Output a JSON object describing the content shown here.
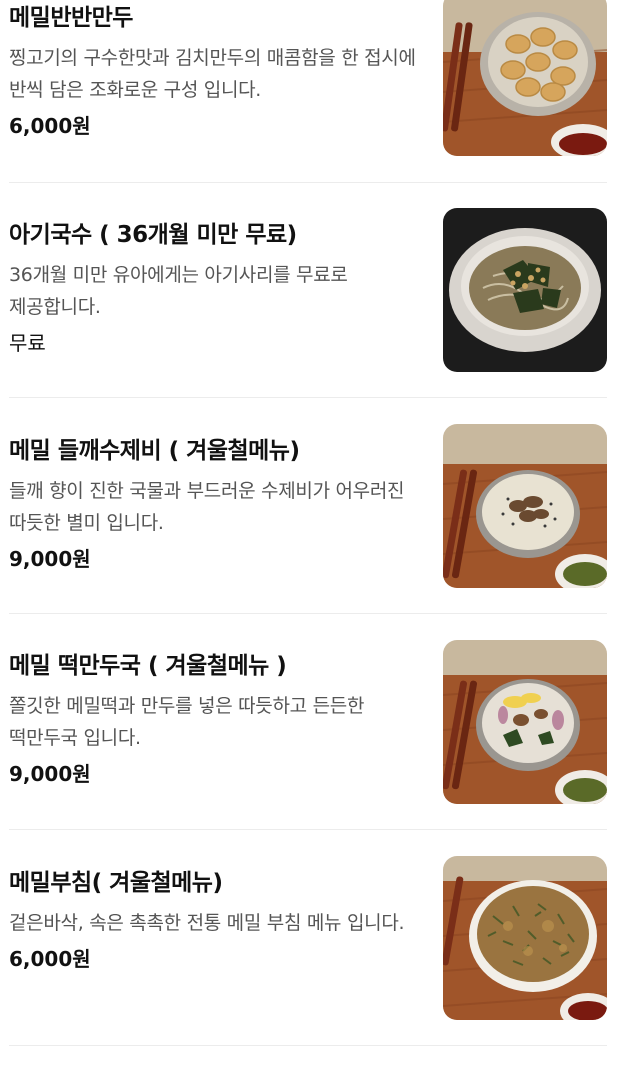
{
  "menu_items": [
    {
      "name": "메밀반반만두",
      "description": "찡고기의 구수한맛과 김치만두의 매콤함을 한 접시에 반씩 담은 조화로운 구성 입니다.",
      "price": "6,000원",
      "image_icon": "dumpling-plate-photo"
    },
    {
      "name": "아기국수 ( 36개월 미만 무료)",
      "description": "36개월 미만 유아에게는 아기사리를 무료로 제공합니다.",
      "price": "무료",
      "image_icon": "baby-noodle-bowl-photo"
    },
    {
      "name": "메밀 들깨수제비 ( 겨울철메뉴)",
      "description": "들깨 향이 진한 국물과 부드러운 수제비가 어우러진 따듯한 별미 입니다.",
      "price": "9,000원",
      "image_icon": "perilla-sujebi-photo"
    },
    {
      "name": "메밀 떡만두국 ( 겨울철메뉴 )",
      "description": "쫄깃한 메밀떡과 만두를 넣은 따듯하고 든든한 떡만두국 입니다.",
      "price": "9,000원",
      "image_icon": "rice-cake-dumpling-soup-photo"
    },
    {
      "name": "메밀부침( 겨울철메뉴)",
      "description": "겉은바삭, 속은 촉촉한 전통 메밀 부침 메뉴 입니다.",
      "price": "6,000원",
      "image_icon": "buckwheat-pancake-photo"
    }
  ],
  "colors": {
    "text_primary": "#111111",
    "text_secondary": "#555555",
    "divider": "#ececec",
    "wood": "#a0552a",
    "dark_bg": "#1c1c1c"
  }
}
